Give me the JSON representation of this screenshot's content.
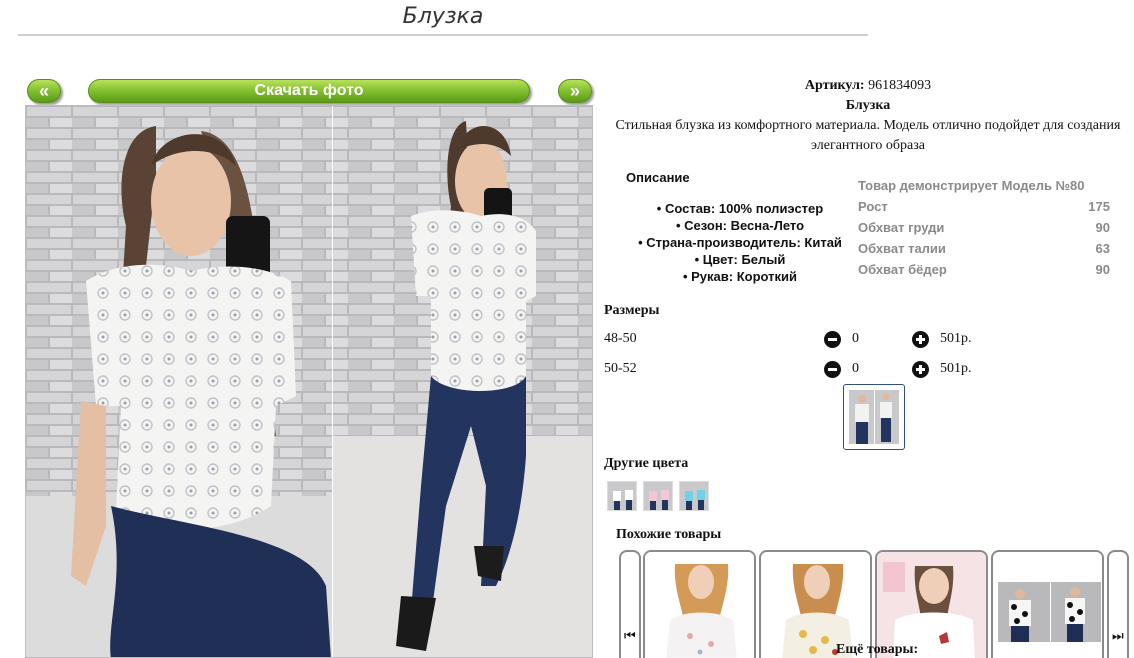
{
  "page": {
    "title": "Блузка"
  },
  "photo_bar": {
    "prev": "«",
    "download": "Скачать фото",
    "next": "»"
  },
  "product": {
    "article_label": "Артикул:",
    "article_value": "961834093",
    "name": "Блузка",
    "description": "Стильная блузка из комфортного материала. Модель отлично подойдет для создания элегантного образа"
  },
  "description_block": {
    "title": "Описание",
    "props": [
      "Состав: 100% полиэстер",
      "Сезон: Весна-Лето",
      "Страна-производитель: Китай",
      "Цвет: Белый",
      "Рукав: Короткий"
    ]
  },
  "model": {
    "title": "Товар демонстрирует Модель №80",
    "rows": [
      {
        "label": "Рост",
        "value": "175"
      },
      {
        "label": "Обхват груди",
        "value": "90"
      },
      {
        "label": "Обхват талии",
        "value": "63"
      },
      {
        "label": "Обхват бёдер",
        "value": "90"
      }
    ]
  },
  "sizes": {
    "title": "Размеры",
    "rows": [
      {
        "size": "48-50",
        "qty": "0",
        "price": "501р."
      },
      {
        "size": "50-52",
        "qty": "0",
        "price": "501р."
      }
    ]
  },
  "other_colors": {
    "title": "Другие цвета",
    "swatches": [
      "#ffffff",
      "#f4c6d6",
      "#6fd0e8"
    ]
  },
  "similar": {
    "title": "Похожие товары",
    "prev": "⏮",
    "next": "⏭",
    "more": "Ещё товары:"
  }
}
